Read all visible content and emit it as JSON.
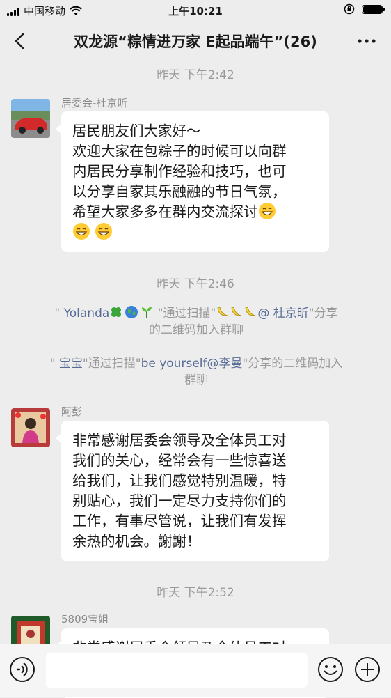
{
  "status_bar": {
    "carrier": "中国移动",
    "time": "上午10:21",
    "battery_level": 0.95
  },
  "header": {
    "title": "双龙源“粽情进万家 E起品端午”(26)"
  },
  "messages": {
    "ts1": "昨天 下午2:42",
    "msg1": {
      "sender": "居委会-杜京昕",
      "lines": [
        "居民朋友们大家好～",
        "欢迎大家在包粽子的时候可以向群",
        "内居民分享制作经验和技巧，也可",
        "以分享自家其乐融融的节日气氛，",
        "希望大家多多在群内交流探讨"
      ]
    },
    "ts2": "昨天 下午2:46",
    "sys1": {
      "q": "\"",
      "name": "Yolanda",
      "via": "\"通过扫描\"",
      "inviter": "@ 杜京昕",
      "tail": "\"分享",
      "line2": "的二维码加入群聊"
    },
    "sys2": {
      "q": "\"",
      "name": "宝宝",
      "via": "\"通过扫描\"",
      "inviter": "be yourself@李曼",
      "tail": "\"分享的二维码加入",
      "line2": "群聊"
    },
    "msg2": {
      "sender": "阿彭",
      "lines": [
        "非常感谢居委会领导及全体员工对",
        "我们的关心，经常会有一些惊喜送",
        "给我们，让我们感觉特别温暖，特",
        "别贴心，我们一定尽力支持你们的",
        "工作，有事尽管说，让我们有发挥",
        "余热的机会。謝謝！"
      ]
    },
    "ts3": "昨天 下午2:52",
    "msg3": {
      "sender": "5809宝姐",
      "lines": [
        "非常感谢居委会领导及全体员工对"
      ]
    }
  },
  "input": {
    "value": ""
  },
  "icons": {
    "back": "chevron-left-icon",
    "more": "more-dots-icon",
    "voice": "voice-icon",
    "emoji": "emoji-icon",
    "plus": "plus-icon"
  }
}
